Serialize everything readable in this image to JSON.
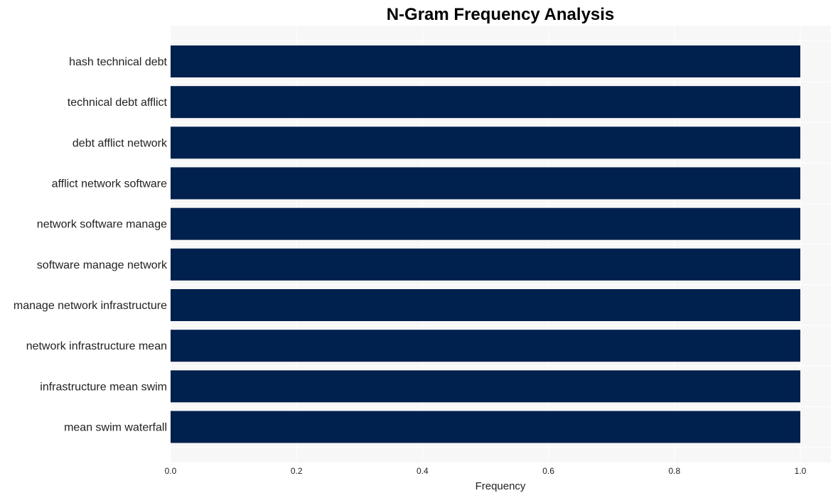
{
  "chart_data": {
    "type": "bar",
    "orientation": "horizontal",
    "title": "N-Gram Frequency Analysis",
    "xlabel": "Frequency",
    "ylabel": "",
    "categories": [
      "hash technical debt",
      "technical debt afflict",
      "debt afflict network",
      "afflict network software",
      "network software manage",
      "software manage network",
      "manage network infrastructure",
      "network infrastructure mean",
      "infrastructure mean swim",
      "mean swim waterfall"
    ],
    "values": [
      1,
      1,
      1,
      1,
      1,
      1,
      1,
      1,
      1,
      1
    ],
    "xlim": [
      0,
      1.05
    ],
    "xticks": [
      0.0,
      0.2,
      0.4,
      0.6,
      0.8,
      1.0
    ],
    "xtick_labels": [
      "0.0",
      "0.2",
      "0.4",
      "0.6",
      "0.8",
      "1.0"
    ],
    "grid": true,
    "legend": "none",
    "colors": {
      "bar": "#00204e",
      "plot_bg": "#f7f7f7",
      "grid": "#ffffff"
    }
  }
}
